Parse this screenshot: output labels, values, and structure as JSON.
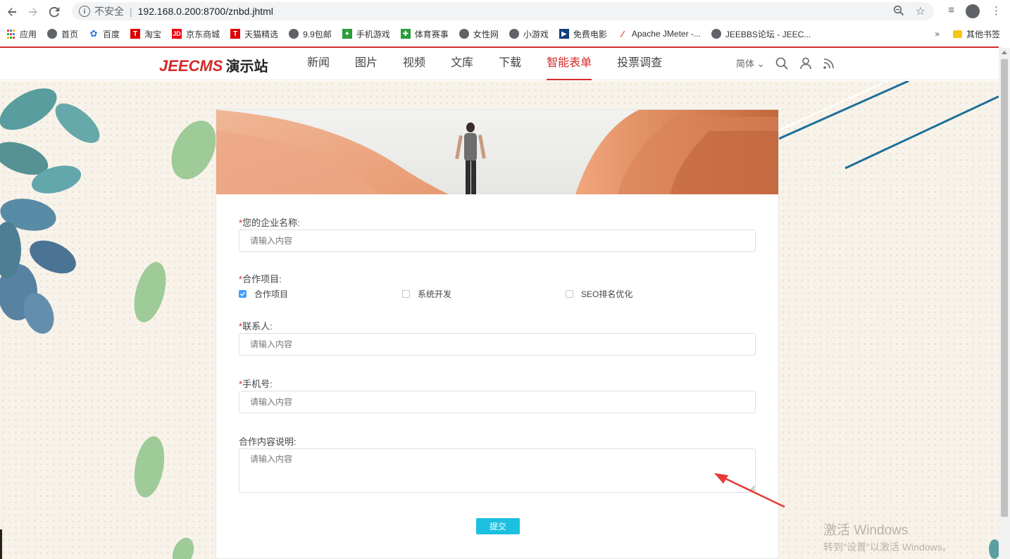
{
  "browser": {
    "insecure_label": "不安全",
    "url": "192.168.0.200:8700/znbd.jhtml",
    "bookmarks": [
      {
        "label": "应用",
        "icon": "apps-icon"
      },
      {
        "label": "首页",
        "icon": "globe-icon"
      },
      {
        "label": "百度",
        "icon": "baidu-paw-icon"
      },
      {
        "label": "淘宝",
        "icon": "tmall-icon"
      },
      {
        "label": "京东商城",
        "icon": "jd-icon"
      },
      {
        "label": "天猫精选",
        "icon": "tmall-icon"
      },
      {
        "label": "9.9包邮",
        "icon": "globe-icon"
      },
      {
        "label": "手机游戏",
        "icon": "game-icon"
      },
      {
        "label": "体育赛事",
        "icon": "sports-icon"
      },
      {
        "label": "女性网",
        "icon": "globe-icon"
      },
      {
        "label": "小游戏",
        "icon": "globe-icon"
      },
      {
        "label": "免费电影",
        "icon": "film-icon"
      },
      {
        "label": "Apache JMeter -...",
        "icon": "feather-icon"
      },
      {
        "label": "JEEBBS论坛 - JEEC...",
        "icon": "globe-icon"
      }
    ],
    "more": "»",
    "other_bookmarks": "其他书签"
  },
  "site": {
    "logo_latin": "JEECMS",
    "logo_cn": "演示站",
    "nav": [
      {
        "label": "新闻",
        "active": false
      },
      {
        "label": "图片",
        "active": false
      },
      {
        "label": "视频",
        "active": false
      },
      {
        "label": "文库",
        "active": false
      },
      {
        "label": "下载",
        "active": false
      },
      {
        "label": "智能表单",
        "active": true
      },
      {
        "label": "投票调查",
        "active": false
      }
    ],
    "lang": "简体 ⌄",
    "accent": "#d42a2a"
  },
  "form": {
    "company": {
      "label": "您的企业名称:",
      "required": "*",
      "placeholder": "请输入内容"
    },
    "project": {
      "label": "合作项目:",
      "required": "*",
      "options": [
        {
          "label": "合作项目",
          "checked": true
        },
        {
          "label": "系统开发",
          "checked": false
        },
        {
          "label": "SEO排名优化",
          "checked": false
        }
      ]
    },
    "contact": {
      "label": "联系人:",
      "required": "*",
      "placeholder": "请输入内容"
    },
    "phone": {
      "label": "手机号:",
      "required": "*",
      "placeholder": "请输入内容"
    },
    "description": {
      "label": "合作内容说明:",
      "placeholder": "请输入内容"
    },
    "submit_label": "提交",
    "submit_color": "#1cc0e0"
  },
  "watermark": {
    "line1": "激活 Windows",
    "line2": "转到\"设置\"以激活 Windows。"
  }
}
